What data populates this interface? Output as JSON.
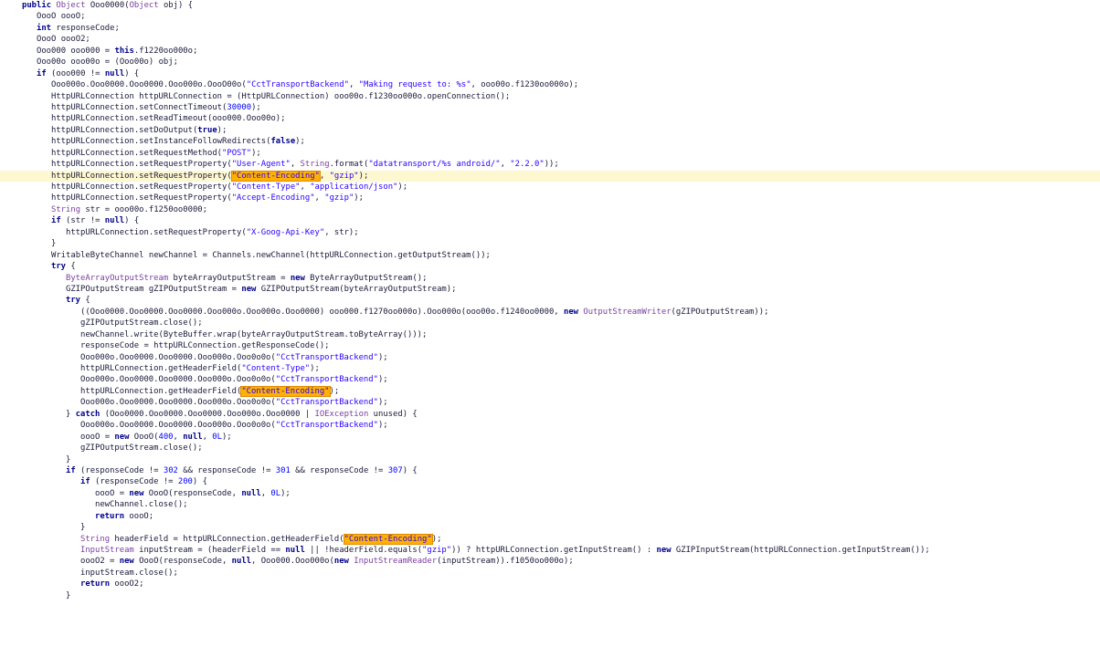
{
  "editor": {
    "highlight_color": "#fdf8d0",
    "search_highlight_color": "#ffb000",
    "lines": [
      {
        "indent": 1,
        "tokens": [
          [
            "kw",
            "public "
          ],
          [
            "cls",
            "Object "
          ],
          [
            "id",
            "Ooo0000("
          ],
          [
            "cls",
            "Object"
          ],
          [
            "id",
            " obj) {"
          ]
        ]
      },
      {
        "indent": 2,
        "tokens": [
          [
            "id",
            "OooO oooO;"
          ]
        ]
      },
      {
        "indent": 2,
        "tokens": [
          [
            "kw",
            "int"
          ],
          [
            "id",
            " responseCode;"
          ]
        ]
      },
      {
        "indent": 2,
        "tokens": [
          [
            "id",
            "OooO oooO2;"
          ]
        ]
      },
      {
        "indent": 2,
        "tokens": [
          [
            "id",
            "Ooo000 ooo000 = "
          ],
          [
            "kw",
            "this"
          ],
          [
            "id",
            ".f1220oo000o;"
          ]
        ]
      },
      {
        "indent": 2,
        "tokens": [
          [
            "id",
            "Ooo00o ooo00o = (Ooo00o) obj;"
          ]
        ]
      },
      {
        "indent": 2,
        "tokens": [
          [
            "kw",
            "if"
          ],
          [
            "id",
            " (ooo000 != "
          ],
          [
            "kw",
            "null"
          ],
          [
            "id",
            ") {"
          ]
        ]
      },
      {
        "indent": 3,
        "tokens": [
          [
            "id",
            "Ooo000o.Ooo0000.Ooo0000.Ooo000o.OooO00o("
          ],
          [
            "str",
            "\"CctTransportBackend\""
          ],
          [
            "id",
            ", "
          ],
          [
            "str",
            "\"Making request to: %s\""
          ],
          [
            "id",
            ", ooo00o.f1230oo000o);"
          ]
        ]
      },
      {
        "indent": 3,
        "tokens": [
          [
            "id",
            "HttpURLConnection httpURLConnection = (HttpURLConnection) ooo00o.f1230oo000o.openConnection();"
          ]
        ]
      },
      {
        "indent": 3,
        "tokens": [
          [
            "id",
            "httpURLConnection.setConnectTimeout("
          ],
          [
            "num",
            "30000"
          ],
          [
            "id",
            ");"
          ]
        ]
      },
      {
        "indent": 3,
        "tokens": [
          [
            "id",
            "httpURLConnection.setReadTimeout(ooo000.Ooo00o);"
          ]
        ]
      },
      {
        "indent": 3,
        "tokens": [
          [
            "id",
            "httpURLConnection.setDoOutput("
          ],
          [
            "kw",
            "true"
          ],
          [
            "id",
            ");"
          ]
        ]
      },
      {
        "indent": 3,
        "tokens": [
          [
            "id",
            "httpURLConnection.setInstanceFollowRedirects("
          ],
          [
            "kw",
            "false"
          ],
          [
            "id",
            ");"
          ]
        ]
      },
      {
        "indent": 3,
        "tokens": [
          [
            "id",
            "httpURLConnection.setRequestMethod("
          ],
          [
            "str",
            "\"POST\""
          ],
          [
            "id",
            ");"
          ]
        ]
      },
      {
        "indent": 3,
        "tokens": [
          [
            "id",
            "httpURLConnection.setRequestProperty("
          ],
          [
            "str",
            "\"User-Agent\""
          ],
          [
            "id",
            ", "
          ],
          [
            "cls",
            "String"
          ],
          [
            "id",
            ".format("
          ],
          [
            "str",
            "\"datatransport/%s android/\""
          ],
          [
            "id",
            ", "
          ],
          [
            "str",
            "\"2.2.0\""
          ],
          [
            "id",
            "));"
          ]
        ]
      },
      {
        "indent": 3,
        "highlight": true,
        "tokens": [
          [
            "id",
            "httpURLConnection.setRequestProperty("
          ],
          [
            "hl",
            "\"Content-Encoding\""
          ],
          [
            "id",
            ", "
          ],
          [
            "str",
            "\"gzip\""
          ],
          [
            "id",
            ");"
          ]
        ]
      },
      {
        "indent": 3,
        "tokens": [
          [
            "id",
            "httpURLConnection.setRequestProperty("
          ],
          [
            "str",
            "\"Content-Type\""
          ],
          [
            "id",
            ", "
          ],
          [
            "str",
            "\"application/json\""
          ],
          [
            "id",
            ");"
          ]
        ]
      },
      {
        "indent": 3,
        "tokens": [
          [
            "id",
            "httpURLConnection.setRequestProperty("
          ],
          [
            "str",
            "\"Accept-Encoding\""
          ],
          [
            "id",
            ", "
          ],
          [
            "str",
            "\"gzip\""
          ],
          [
            "id",
            ");"
          ]
        ]
      },
      {
        "indent": 3,
        "tokens": [
          [
            "cls",
            "String"
          ],
          [
            "id",
            " str = ooo00o.f1250oo0000;"
          ]
        ]
      },
      {
        "indent": 3,
        "tokens": [
          [
            "kw",
            "if"
          ],
          [
            "id",
            " (str != "
          ],
          [
            "kw",
            "null"
          ],
          [
            "id",
            ") {"
          ]
        ]
      },
      {
        "indent": 4,
        "tokens": [
          [
            "id",
            "httpURLConnection.setRequestProperty("
          ],
          [
            "str",
            "\"X-Goog-Api-Key\""
          ],
          [
            "id",
            ", str);"
          ]
        ]
      },
      {
        "indent": 3,
        "tokens": [
          [
            "id",
            "}"
          ]
        ]
      },
      {
        "indent": 3,
        "tokens": [
          [
            "id",
            "WritableByteChannel newChannel = Channels.newChannel(httpURLConnection.getOutputStream());"
          ]
        ]
      },
      {
        "indent": 3,
        "tokens": [
          [
            "kw",
            "try"
          ],
          [
            "id",
            " {"
          ]
        ]
      },
      {
        "indent": 4,
        "tokens": [
          [
            "cls",
            "ByteArrayOutputStream"
          ],
          [
            "id",
            " byteArrayOutputStream = "
          ],
          [
            "kw",
            "new"
          ],
          [
            "id",
            " ByteArrayOutputStream();"
          ]
        ]
      },
      {
        "indent": 4,
        "tokens": [
          [
            "id",
            "GZIPOutputStream gZIPOutputStream = "
          ],
          [
            "kw",
            "new"
          ],
          [
            "id",
            " GZIPOutputStream(byteArrayOutputStream);"
          ]
        ]
      },
      {
        "indent": 4,
        "tokens": [
          [
            "kw",
            "try"
          ],
          [
            "id",
            " {"
          ]
        ]
      },
      {
        "indent": 5,
        "tokens": [
          [
            "id",
            "((Ooo0000.Ooo0000.Ooo0000.Ooo000o.Ooo000o.Ooo0000) ooo000.f1270oo000o).Ooo000o(ooo00o.f1240oo0000, "
          ],
          [
            "kw",
            "new"
          ],
          [
            "id",
            " "
          ],
          [
            "cls",
            "OutputStreamWriter"
          ],
          [
            "id",
            "(gZIPOutputStream));"
          ]
        ]
      },
      {
        "indent": 5,
        "tokens": [
          [
            "id",
            "gZIPOutputStream.close();"
          ]
        ]
      },
      {
        "indent": 5,
        "tokens": [
          [
            "id",
            "newChannel.write(ByteBuffer.wrap(byteArrayOutputStream.toByteArray()));"
          ]
        ]
      },
      {
        "indent": 5,
        "tokens": [
          [
            "id",
            "responseCode = httpURLConnection.getResponseCode();"
          ]
        ]
      },
      {
        "indent": 5,
        "tokens": [
          [
            "id",
            "Ooo000o.Ooo0000.Ooo0000.Ooo000o.Ooo0o0o("
          ],
          [
            "str",
            "\"CctTransportBackend\""
          ],
          [
            "id",
            ");"
          ]
        ]
      },
      {
        "indent": 5,
        "tokens": [
          [
            "id",
            "httpURLConnection.getHeaderField("
          ],
          [
            "str",
            "\"Content-Type\""
          ],
          [
            "id",
            ");"
          ]
        ]
      },
      {
        "indent": 5,
        "tokens": [
          [
            "id",
            "Ooo000o.Ooo0000.Ooo0000.Ooo000o.Ooo0o0o("
          ],
          [
            "str",
            "\"CctTransportBackend\""
          ],
          [
            "id",
            ");"
          ]
        ]
      },
      {
        "indent": 5,
        "tokens": [
          [
            "id",
            "httpURLConnection.getHeaderField("
          ],
          [
            "hl",
            "\"Content-Encoding\""
          ],
          [
            "id",
            ");"
          ]
        ]
      },
      {
        "indent": 5,
        "tokens": [
          [
            "id",
            "Ooo000o.Ooo0000.Ooo0000.Ooo000o.Ooo0o0o("
          ],
          [
            "str",
            "\"CctTransportBackend\""
          ],
          [
            "id",
            ");"
          ]
        ]
      },
      {
        "indent": 4,
        "tokens": [
          [
            "id",
            "} "
          ],
          [
            "kw",
            "catch"
          ],
          [
            "id",
            " (Ooo0000.Ooo0000.Ooo0000.Ooo000o.Ooo0000 | "
          ],
          [
            "cls",
            "IOException"
          ],
          [
            "id",
            " unused) {"
          ]
        ]
      },
      {
        "indent": 5,
        "tokens": [
          [
            "id",
            "Ooo000o.Ooo0000.Ooo0000.Ooo000o.Ooo0o0o("
          ],
          [
            "str",
            "\"CctTransportBackend\""
          ],
          [
            "id",
            ");"
          ]
        ]
      },
      {
        "indent": 5,
        "tokens": [
          [
            "id",
            "oooO = "
          ],
          [
            "kw",
            "new"
          ],
          [
            "id",
            " OooO("
          ],
          [
            "num",
            "400"
          ],
          [
            "id",
            ", "
          ],
          [
            "kw",
            "null"
          ],
          [
            "id",
            ", "
          ],
          [
            "num",
            "0L"
          ],
          [
            "id",
            ");"
          ]
        ]
      },
      {
        "indent": 5,
        "tokens": [
          [
            "id",
            "gZIPOutputStream.close();"
          ]
        ]
      },
      {
        "indent": 4,
        "tokens": [
          [
            "id",
            "}"
          ]
        ]
      },
      {
        "indent": 4,
        "tokens": [
          [
            "kw",
            "if"
          ],
          [
            "id",
            " (responseCode != "
          ],
          [
            "num",
            "302"
          ],
          [
            "id",
            " && responseCode != "
          ],
          [
            "num",
            "301"
          ],
          [
            "id",
            " && responseCode != "
          ],
          [
            "num",
            "307"
          ],
          [
            "id",
            ") {"
          ]
        ]
      },
      {
        "indent": 5,
        "tokens": [
          [
            "kw",
            "if"
          ],
          [
            "id",
            " (responseCode != "
          ],
          [
            "num",
            "200"
          ],
          [
            "id",
            ") {"
          ]
        ]
      },
      {
        "indent": 6,
        "tokens": [
          [
            "id",
            "oooO = "
          ],
          [
            "kw",
            "new"
          ],
          [
            "id",
            " OooO(responseCode, "
          ],
          [
            "kw",
            "null"
          ],
          [
            "id",
            ", "
          ],
          [
            "num",
            "0L"
          ],
          [
            "id",
            ");"
          ]
        ]
      },
      {
        "indent": 6,
        "tokens": [
          [
            "id",
            "newChannel.close();"
          ]
        ]
      },
      {
        "indent": 6,
        "tokens": [
          [
            "kw",
            "return"
          ],
          [
            "id",
            " oooO;"
          ]
        ]
      },
      {
        "indent": 5,
        "tokens": [
          [
            "id",
            "}"
          ]
        ]
      },
      {
        "indent": 5,
        "tokens": [
          [
            "cls",
            "String"
          ],
          [
            "id",
            " headerField = httpURLConnection.getHeaderField("
          ],
          [
            "hl",
            "\"Content-Encoding\""
          ],
          [
            "id",
            ");"
          ]
        ]
      },
      {
        "indent": 5,
        "tokens": [
          [
            "cls",
            "InputStream"
          ],
          [
            "id",
            " inputStream = (headerField == "
          ],
          [
            "kw",
            "null"
          ],
          [
            "id",
            " || !headerField.equals("
          ],
          [
            "str",
            "\"gzip\""
          ],
          [
            "id",
            ")) ? httpURLConnection.getInputStream() : "
          ],
          [
            "kw",
            "new"
          ],
          [
            "id",
            " GZIPInputStream(httpURLConnection.getInputStream());"
          ]
        ]
      },
      {
        "indent": 5,
        "tokens": [
          [
            "id",
            "oooO2 = "
          ],
          [
            "kw",
            "new"
          ],
          [
            "id",
            " OooO(responseCode, "
          ],
          [
            "kw",
            "null"
          ],
          [
            "id",
            ", Ooo000.Ooo000o("
          ],
          [
            "kw",
            "new"
          ],
          [
            "id",
            " "
          ],
          [
            "cls",
            "InputStreamReader"
          ],
          [
            "id",
            "(inputStream)).f1050oo000o);"
          ]
        ]
      },
      {
        "indent": 5,
        "tokens": [
          [
            "id",
            "inputStream.close();"
          ]
        ]
      },
      {
        "indent": 5,
        "tokens": [
          [
            "kw",
            "return"
          ],
          [
            "id",
            " oooO2;"
          ]
        ]
      },
      {
        "indent": 4,
        "tokens": [
          [
            "id",
            "}"
          ]
        ]
      }
    ]
  }
}
